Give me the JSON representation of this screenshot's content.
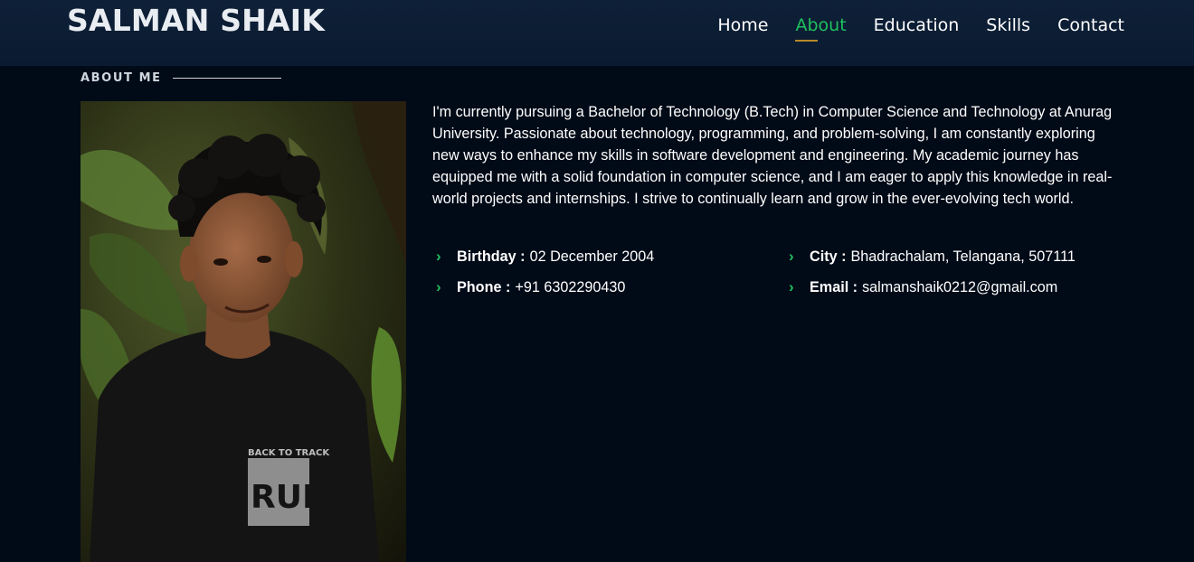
{
  "header": {
    "logo": "SALMAN SHAIK",
    "nav": [
      {
        "label": "Home"
      },
      {
        "label": "About"
      },
      {
        "label": "Education"
      },
      {
        "label": "Skills"
      },
      {
        "label": "Contact"
      }
    ],
    "active_nav": "About",
    "accent_color": "#20c05f"
  },
  "about": {
    "section_title": "ABOUT ME",
    "bio": "I'm currently pursuing a Bachelor of Technology (B.Tech) in Computer Science and Technology at Anurag University. Passionate about technology, programming, and problem-solving, I am constantly exploring new ways to enhance my skills in software development and engineering. My academic journey has equipped me with a solid foundation in computer science, and I am eager to apply this knowledge in real-world projects and internships. I strive to continually learn and grow in the ever-evolving tech world.",
    "photo": {
      "shirt_text_top": "BACK TO TRACK",
      "shirt_text_main": "RUN"
    },
    "details": {
      "birthday": {
        "label": "Birthday :",
        "value": "02 December 2004"
      },
      "city": {
        "label": "City :",
        "value": "Bhadrachalam, Telangana, 507111"
      },
      "phone": {
        "label": "Phone :",
        "value": "+91 6302290430"
      },
      "email": {
        "label": "Email :",
        "value": "salmanshaik0212@gmail.com"
      }
    },
    "chevron_icon": "chevron-right-icon"
  }
}
